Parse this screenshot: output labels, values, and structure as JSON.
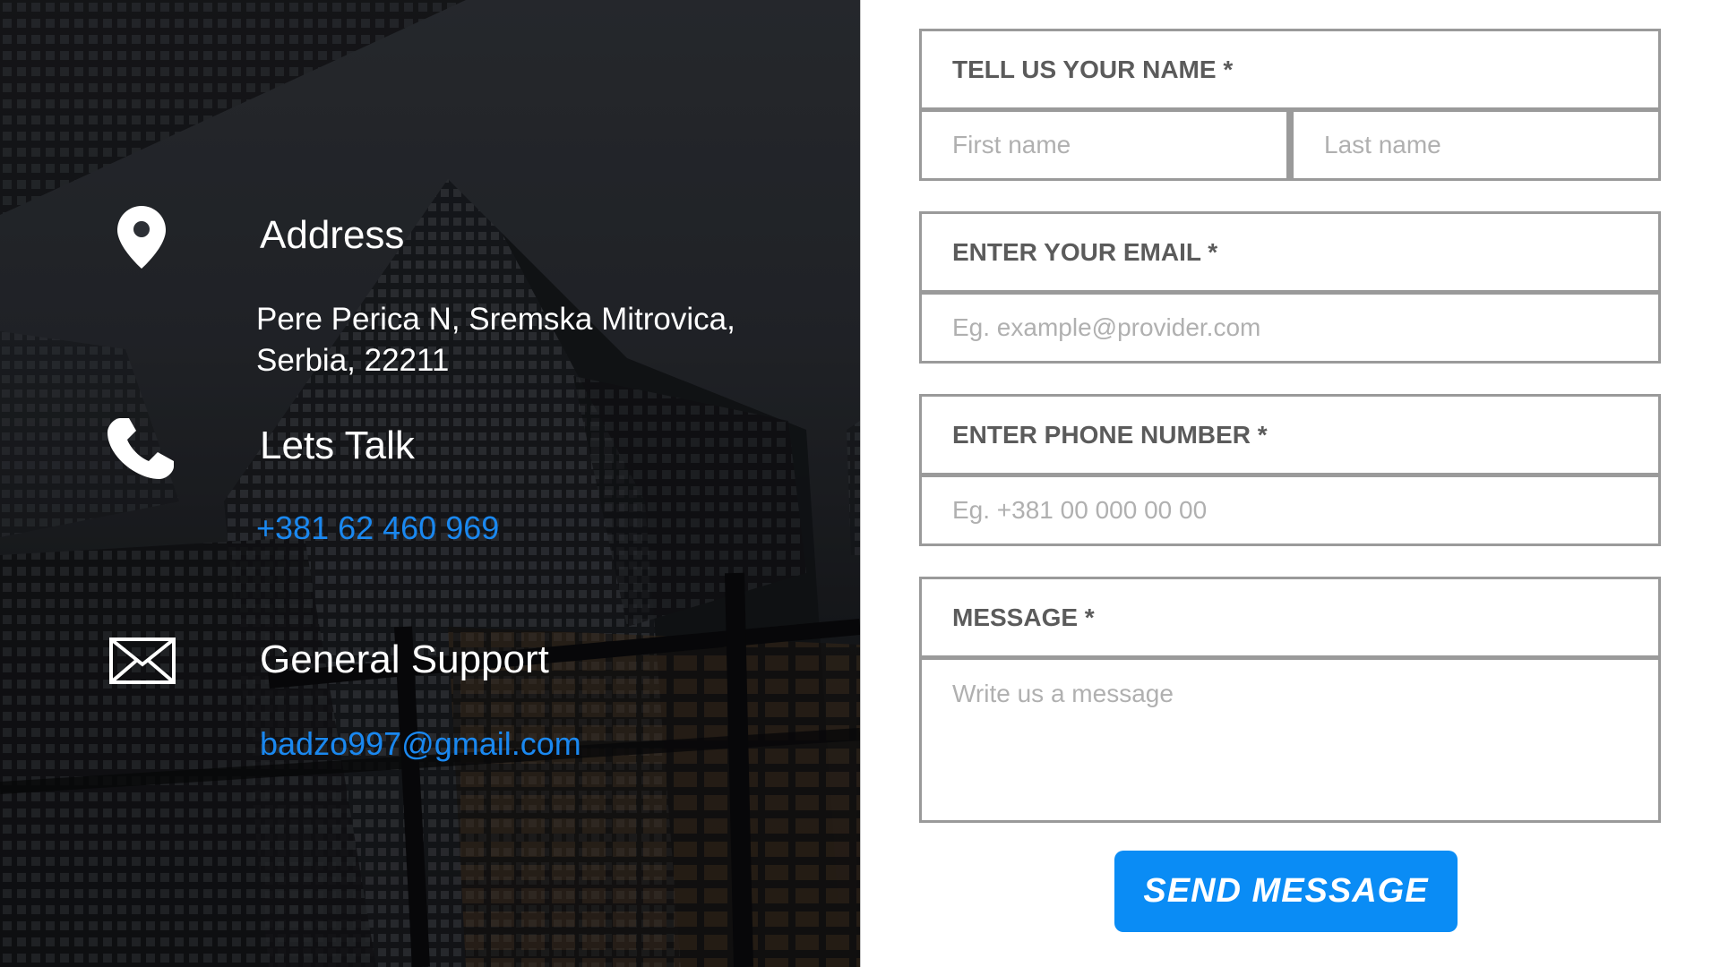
{
  "contact_info": {
    "address": {
      "icon": "location-pin-icon",
      "title": "Address",
      "line1": "Pere Perica  N, Sremska Mitrovica,",
      "line2": "Serbia, 22211"
    },
    "phone": {
      "icon": "phone-icon",
      "title": "Lets Talk",
      "value": "+381 62 460 969"
    },
    "support": {
      "icon": "envelope-icon",
      "title": "General Support",
      "value": "badzo997@gmail.com"
    },
    "link_color": "#1a88f0"
  },
  "form": {
    "name": {
      "label": "TELL US YOUR NAME *",
      "first_placeholder": "First name",
      "last_placeholder": "Last name"
    },
    "email": {
      "label": "ENTER YOUR EMAIL *",
      "placeholder": "Eg. example@provider.com"
    },
    "phone": {
      "label": "ENTER PHONE NUMBER *",
      "placeholder": "Eg. +381 00 000 00 00"
    },
    "message": {
      "label": "MESSAGE *",
      "placeholder": "Write us a message"
    },
    "submit_label": "SEND MESSAGE",
    "accent_color": "#0a8cf5"
  }
}
